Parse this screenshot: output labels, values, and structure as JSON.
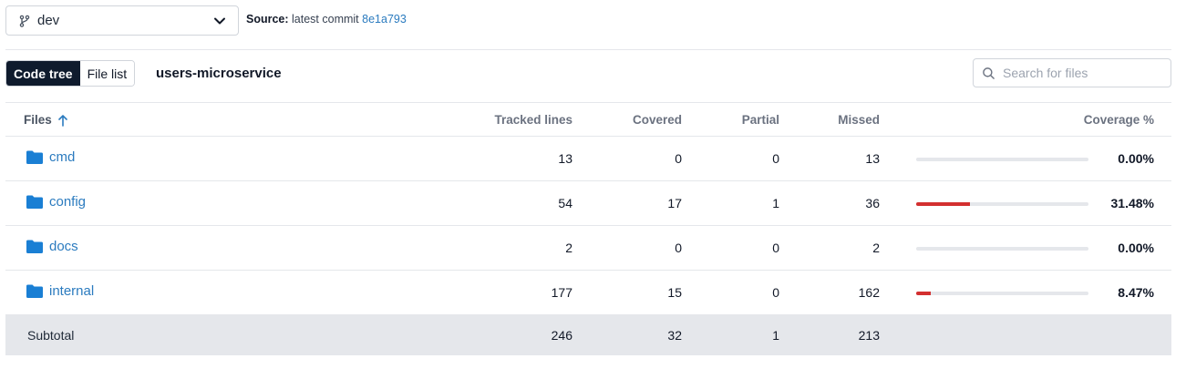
{
  "branch": {
    "name": "dev"
  },
  "source": {
    "label": "Source:",
    "text": "latest commit",
    "commit": "8e1a793"
  },
  "view_toggle": {
    "active": "Code tree",
    "inactive": "File list"
  },
  "repo_name": "users-microservice",
  "search": {
    "placeholder": "Search for files",
    "value": ""
  },
  "table": {
    "headers": {
      "files": "Files",
      "tracked": "Tracked lines",
      "covered": "Covered",
      "partial": "Partial",
      "missed": "Missed",
      "coverage": "Coverage %"
    },
    "rows": [
      {
        "name": "cmd",
        "tracked": "13",
        "covered": "0",
        "partial": "0",
        "missed": "13",
        "coverage": "0.00%",
        "coverage_value": 0.0
      },
      {
        "name": "config",
        "tracked": "54",
        "covered": "17",
        "partial": "1",
        "missed": "36",
        "coverage": "31.48%",
        "coverage_value": 31.48
      },
      {
        "name": "docs",
        "tracked": "2",
        "covered": "0",
        "partial": "0",
        "missed": "2",
        "coverage": "0.00%",
        "coverage_value": 0.0
      },
      {
        "name": "internal",
        "tracked": "177",
        "covered": "15",
        "partial": "0",
        "missed": "162",
        "coverage": "8.47%",
        "coverage_value": 8.47
      }
    ],
    "subtotal": {
      "label": "Subtotal",
      "tracked": "246",
      "covered": "32",
      "partial": "1",
      "missed": "213"
    }
  },
  "colors": {
    "accent": "#2b7bbf",
    "coverage_bar": "#d32f2f",
    "toggle_active": "#0f1b2d"
  },
  "icons": {
    "branch": "git-branch-icon",
    "dropdown": "chevron-down-icon",
    "search": "search-icon",
    "folder": "folder-icon",
    "sort": "arrow-up-icon"
  }
}
